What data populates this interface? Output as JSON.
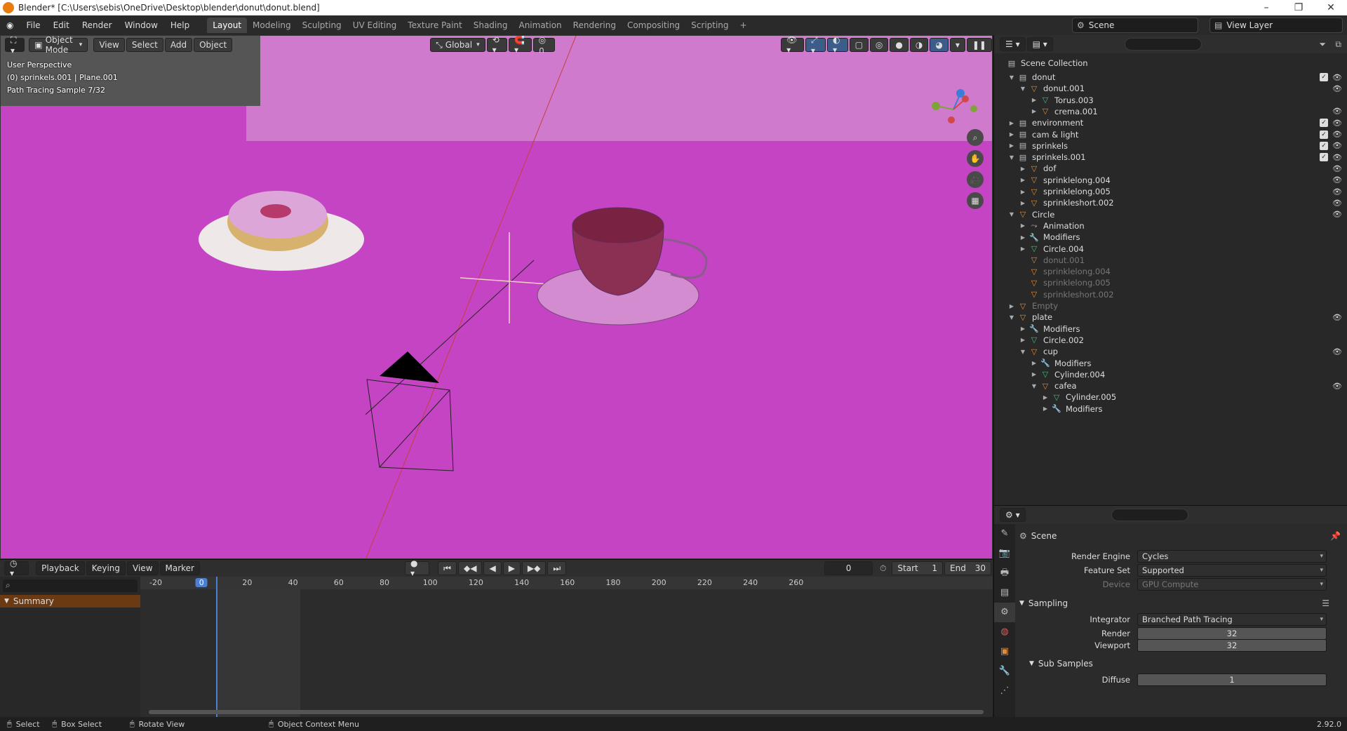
{
  "window": {
    "title": "Blender* [C:\\Users\\sebis\\OneDrive\\Desktop\\blender\\donut\\donut.blend]"
  },
  "menu": [
    "File",
    "Edit",
    "Render",
    "Window",
    "Help"
  ],
  "workspaces": [
    "Layout",
    "Modeling",
    "Sculpting",
    "UV Editing",
    "Texture Paint",
    "Shading",
    "Animation",
    "Rendering",
    "Compositing",
    "Scripting"
  ],
  "active_workspace": "Layout",
  "scene_name": "Scene",
  "view_layer": "View Layer",
  "viewport": {
    "mode": "Object Mode",
    "menus": [
      "View",
      "Select",
      "Add",
      "Object"
    ],
    "orientation": "Global",
    "info": {
      "perspective": "User Perspective",
      "selection": "(0) sprinkels.001 | Plane.001",
      "sample": "Path Tracing Sample 7/32"
    },
    "background_color": "#c444c4"
  },
  "outliner": {
    "root": "Scene Collection",
    "rows": [
      {
        "label": "donut",
        "depth": 0,
        "type": "collection",
        "expanded": true,
        "check": true,
        "eye": true
      },
      {
        "label": "donut.001",
        "depth": 1,
        "type": "object",
        "expanded": true,
        "eye": true
      },
      {
        "label": "Torus.003",
        "depth": 2,
        "type": "mesh",
        "expanded": false
      },
      {
        "label": "crema.001",
        "depth": 2,
        "type": "object",
        "expanded": false,
        "eye": true
      },
      {
        "label": "environment",
        "depth": 0,
        "type": "collection",
        "expanded": false,
        "check": true,
        "eye": true
      },
      {
        "label": "cam & light",
        "depth": 0,
        "type": "collection",
        "expanded": false,
        "check": true,
        "eye": true
      },
      {
        "label": "sprinkels",
        "depth": 0,
        "type": "collection",
        "expanded": false,
        "check": true,
        "eye": true
      },
      {
        "label": "sprinkels.001",
        "depth": 0,
        "type": "collection",
        "expanded": true,
        "check": true,
        "eye": true
      },
      {
        "label": "dof",
        "depth": 1,
        "type": "object",
        "expanded": false,
        "eye": true
      },
      {
        "label": "sprinklelong.004",
        "depth": 1,
        "type": "object",
        "expanded": false,
        "eye": true
      },
      {
        "label": "sprinklelong.005",
        "depth": 1,
        "type": "object",
        "expanded": false,
        "eye": true
      },
      {
        "label": "sprinkleshort.002",
        "depth": 1,
        "type": "object",
        "expanded": false,
        "eye": true
      },
      {
        "label": "Circle",
        "depth": 0,
        "type": "object",
        "expanded": true,
        "eye": true
      },
      {
        "label": "Animation",
        "depth": 1,
        "type": "anim",
        "expanded": false
      },
      {
        "label": "Modifiers",
        "depth": 1,
        "type": "modifier",
        "expanded": false
      },
      {
        "label": "Circle.004",
        "depth": 1,
        "type": "mesh",
        "expanded": false
      },
      {
        "label": "donut.001",
        "depth": 1,
        "type": "object",
        "dim": true
      },
      {
        "label": "sprinklelong.004",
        "depth": 1,
        "type": "object",
        "dim": true
      },
      {
        "label": "sprinklelong.005",
        "depth": 1,
        "type": "object",
        "dim": true
      },
      {
        "label": "sprinkleshort.002",
        "depth": 1,
        "type": "object",
        "dim": true
      },
      {
        "label": "Empty",
        "depth": 0,
        "type": "object",
        "expanded": false,
        "dim": true
      },
      {
        "label": "plate",
        "depth": 0,
        "type": "object",
        "expanded": true,
        "eye": true
      },
      {
        "label": "Modifiers",
        "depth": 1,
        "type": "modifier",
        "expanded": false
      },
      {
        "label": "Circle.002",
        "depth": 1,
        "type": "mesh",
        "expanded": false
      },
      {
        "label": "cup",
        "depth": 1,
        "type": "object",
        "expanded": true,
        "eye": true
      },
      {
        "label": "Modifiers",
        "depth": 2,
        "type": "modifier",
        "expanded": false
      },
      {
        "label": "Cylinder.004",
        "depth": 2,
        "type": "mesh",
        "expanded": false
      },
      {
        "label": "cafea",
        "depth": 2,
        "type": "object",
        "expanded": true,
        "eye": true
      },
      {
        "label": "Cylinder.005",
        "depth": 3,
        "type": "mesh",
        "expanded": false
      },
      {
        "label": "Modifiers",
        "depth": 3,
        "type": "modifier",
        "expanded": false
      }
    ]
  },
  "properties": {
    "context": "Scene",
    "render_engine_label": "Render Engine",
    "render_engine": "Cycles",
    "feature_set_label": "Feature Set",
    "feature_set": "Supported",
    "device_label": "Device",
    "device": "GPU Compute",
    "sampling_label": "Sampling",
    "integrator_label": "Integrator",
    "integrator": "Branched Path Tracing",
    "render_label": "Render",
    "render_samples": "32",
    "viewport_label": "Viewport",
    "viewport_samples": "32",
    "subsamples_label": "Sub Samples",
    "diffuse_label": "Diffuse",
    "diffuse": "1"
  },
  "timeline": {
    "menus": [
      "Playback",
      "Keying",
      "View",
      "Marker"
    ],
    "current_frame": "0",
    "start_label": "Start",
    "start": "1",
    "end_label": "End",
    "end": "30",
    "ticks": [
      "-20",
      "0",
      "20",
      "40",
      "60",
      "80",
      "100",
      "120",
      "140",
      "160",
      "180",
      "200",
      "220",
      "240",
      "260"
    ],
    "summary": "Summary"
  },
  "statusbar": {
    "items": [
      "Select",
      "Box Select",
      "Rotate View",
      "Object Context Menu"
    ],
    "version": "2.92.0"
  }
}
